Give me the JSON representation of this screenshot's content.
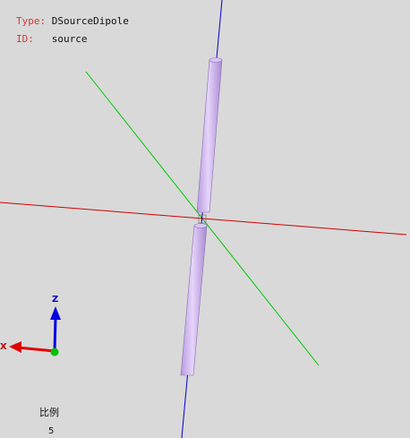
{
  "info": {
    "type_label": "Type:",
    "type_value": "DSourceDipole",
    "id_label": "ID:",
    "id_value": "source"
  },
  "triad": {
    "z_label": "Z",
    "x_label": "X"
  },
  "scale": {
    "label": "比例",
    "value": "5"
  },
  "colors": {
    "background": "#d9d9d9",
    "axis_x": "#d00000",
    "axis_y": "#00c800",
    "axis_z": "#0000d0",
    "dipole": "#ccb0f0",
    "info_key": "#d23a3a"
  }
}
